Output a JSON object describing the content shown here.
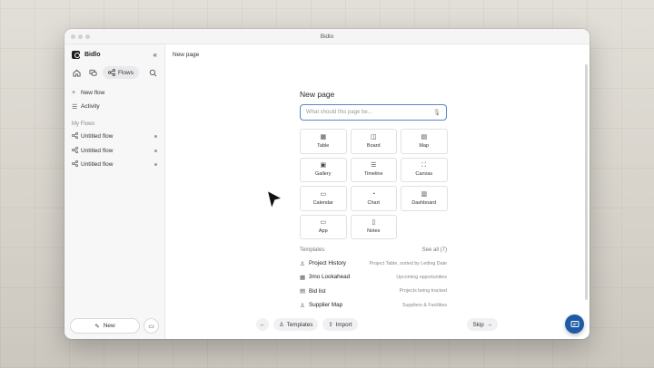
{
  "window": {
    "title": "Bidlo"
  },
  "sidebar": {
    "brand": "Bidlo",
    "flows_tab": "Flows",
    "items": [
      {
        "label": "New flow",
        "icon": "plus-icon"
      },
      {
        "label": "Activity",
        "icon": "list-icon"
      }
    ],
    "section": "My Flows",
    "flows": [
      "Untitled flow",
      "Untitled flow",
      "Untitled flow"
    ],
    "new_button": "New"
  },
  "main": {
    "page_title": "New page",
    "panel": {
      "heading": "New page",
      "placeholder": "What should this page be...",
      "tiles": [
        {
          "label": "Table",
          "icon": "▦"
        },
        {
          "label": "Board",
          "icon": "◫"
        },
        {
          "label": "Map",
          "icon": "▤"
        },
        {
          "label": "Gallery",
          "icon": "▣"
        },
        {
          "label": "Timeline",
          "icon": "☰"
        },
        {
          "label": "Canvas",
          "icon": "⛶"
        },
        {
          "label": "Calendar",
          "icon": "▭"
        },
        {
          "label": "Chart",
          "icon": "◔"
        },
        {
          "label": "Dashboard",
          "icon": "▥"
        },
        {
          "label": "App",
          "icon": "▭"
        },
        {
          "label": "Notes",
          "icon": "▯"
        }
      ],
      "templates_label": "Templates",
      "see_all": "See all (7)",
      "templates": [
        {
          "name": "Project History",
          "desc": "Project Table, sorted by Letting Date",
          "icon": "♙"
        },
        {
          "name": "3mo Lookahead",
          "desc": "Upcoming opportunities",
          "icon": "▦"
        },
        {
          "name": "Bid list",
          "desc": "Projects being tracked",
          "icon": "▤"
        },
        {
          "name": "Supplier Map",
          "desc": "Suppliers & Facilities",
          "icon": "♙"
        }
      ]
    },
    "footer": {
      "templates_label": "Templates",
      "import_label": "Import",
      "skip_label": "Skip"
    }
  },
  "colors": {
    "accent": "#1f5aa6",
    "focus_border": "#5b86c6"
  }
}
